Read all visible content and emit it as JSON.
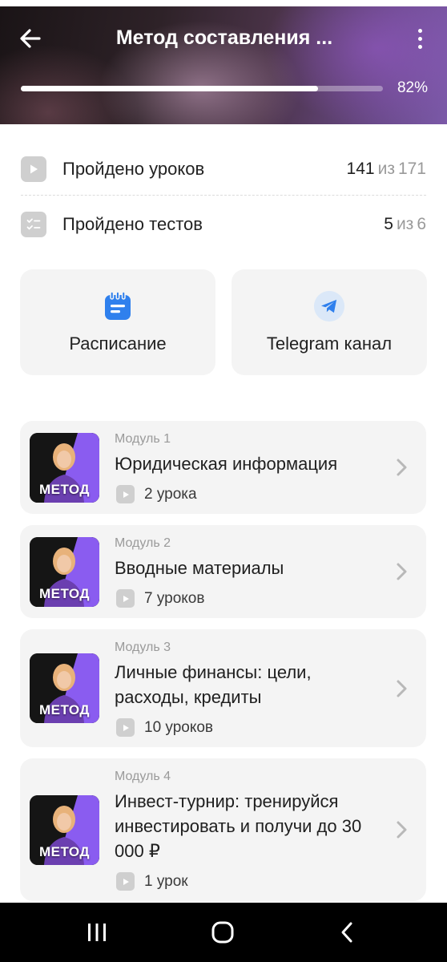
{
  "header": {
    "title": "Метод составления ...",
    "progress_percent": 82,
    "progress_label": "82%",
    "colors": {
      "gradient_start": "#1a1416",
      "gradient_end": "#7b59a8"
    }
  },
  "stats": {
    "lessons": {
      "label": "Пройдено уроков",
      "done": "141",
      "sep": "из",
      "total": "171",
      "icon": "play-icon"
    },
    "tests": {
      "label": "Пройдено тестов",
      "done": "5",
      "sep": "из",
      "total": "6",
      "icon": "checklist-icon"
    }
  },
  "actions": {
    "schedule": {
      "label": "Расписание",
      "icon": "calendar-icon",
      "color": "#2f80ed"
    },
    "telegram": {
      "label": "Telegram канал",
      "icon": "telegram-icon",
      "color": "#2f80ed"
    }
  },
  "modules": [
    {
      "number": "Модуль 1",
      "title": "Юридическая информация",
      "lessons": "2 урока",
      "thumb_label": "МЕТОД"
    },
    {
      "number": "Модуль 2",
      "title": "Вводные материалы",
      "lessons": "7 уроков",
      "thumb_label": "МЕТОД"
    },
    {
      "number": "Модуль 3",
      "title": "Личные финансы: цели, расходы, кредиты",
      "lessons": "10 уроков",
      "thumb_label": "МЕТОД"
    },
    {
      "number": "Модуль 4",
      "title": "Инвест-турнир: тренируйся инвестировать и получи до 30 000 ₽",
      "lessons": "1 урок",
      "thumb_label": "МЕТОД"
    }
  ],
  "navbar": {
    "icons": [
      "recent-apps-icon",
      "home-icon",
      "back-icon"
    ]
  }
}
